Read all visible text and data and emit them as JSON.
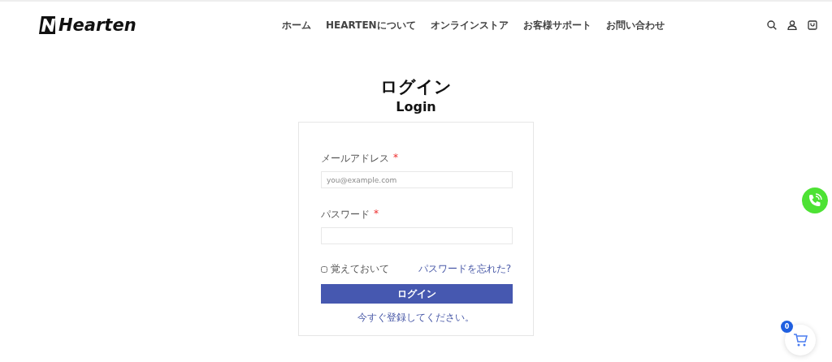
{
  "header": {
    "logo": "Hearten",
    "nav": [
      "ホーム",
      "HEARTENについて",
      "オンラインストア",
      "お客様サポート",
      "お問い合わせ"
    ]
  },
  "page": {
    "title": "ログイン",
    "subtitle": "Login"
  },
  "form": {
    "fields": [
      {
        "label": "メールアドレス",
        "required_mark": "*",
        "placeholder": "you@example.com"
      },
      {
        "label": "パスワード",
        "required_mark": "*"
      }
    ],
    "remember": {
      "label": "覚えておいて",
      "checked": false
    },
    "forgot_link": "パスワードを忘れた?",
    "submit": "ログイン",
    "register_link": "今すぐ登録してください。"
  },
  "cart": {
    "count": "0"
  }
}
